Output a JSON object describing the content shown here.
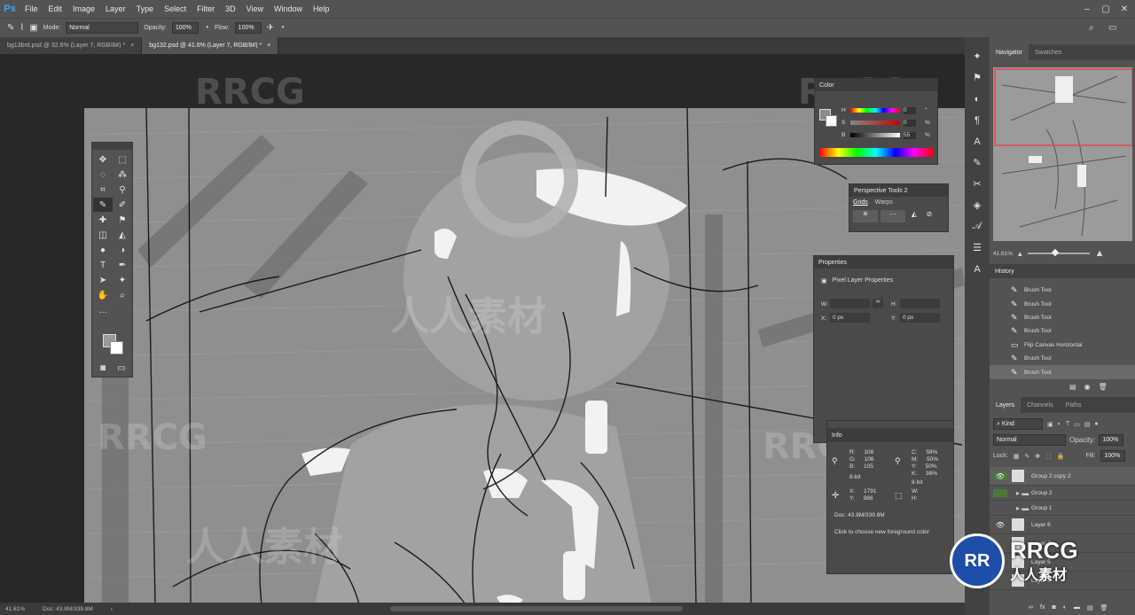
{
  "app": {
    "logo": "Ps",
    "menu": [
      "File",
      "Edit",
      "Image",
      "Layer",
      "Type",
      "Select",
      "Filter",
      "3D",
      "View",
      "Window",
      "Help"
    ]
  },
  "options": {
    "mode_label": "Mode:",
    "mode_value": "Normal",
    "opacity_label": "Opacity:",
    "opacity_value": "100%",
    "flow_label": "Flow:",
    "flow_value": "100%"
  },
  "tabs": [
    {
      "label": "bg13brd.psd @ 32.6% (Layer 7, RGB/8#) *",
      "close": "×"
    },
    {
      "label": "bg132.psd @ 41.6% (Layer 7, RGB/8#) *",
      "close": "×"
    }
  ],
  "color_panel": {
    "title": "Color",
    "channels": [
      {
        "label": "H",
        "value": "0",
        "unit": "°"
      },
      {
        "label": "S",
        "value": "0",
        "unit": "%"
      },
      {
        "label": "B",
        "value": "55",
        "unit": "%"
      }
    ]
  },
  "perspective_panel": {
    "title": "Perspective Tools 2",
    "tabs": [
      "Grids",
      "Warps"
    ]
  },
  "properties_panel": {
    "title": "Properties",
    "subtitle": "Pixel Layer Properties",
    "w_label": "W:",
    "h_label": "H:",
    "x_label": "X:",
    "x_value": "0 px",
    "y_label": "Y:",
    "y_value": "0 px"
  },
  "info_panel": {
    "title": "Info",
    "rgb": [
      {
        "k": "R:",
        "v": "108"
      },
      {
        "k": "G:",
        "v": "106"
      },
      {
        "k": "B:",
        "v": "105"
      }
    ],
    "bit_left": "8-bit",
    "cmyk": [
      {
        "k": "C:",
        "v": "59%"
      },
      {
        "k": "M:",
        "v": "50%"
      },
      {
        "k": "Y:",
        "v": "50%"
      },
      {
        "k": "K:",
        "v": "38%"
      }
    ],
    "bit_right": "8-bit",
    "x": {
      "k": "X:",
      "v": "1791"
    },
    "y": {
      "k": "Y:",
      "v": "986"
    },
    "w": {
      "k": "W:",
      "v": ""
    },
    "h": {
      "k": "H:",
      "v": ""
    },
    "doc": "Doc: 43.8M/339.8M",
    "hint": "Click to choose new foreground color"
  },
  "navigator": {
    "tabs": [
      "Navigator",
      "Swatches"
    ],
    "zoom": "41.61%"
  },
  "history": {
    "title": "History",
    "items": [
      "Brush Tool",
      "Brush Tool",
      "Brush Tool",
      "Brush Tool",
      "Flip Canvas Horizontal",
      "Brush Tool",
      "Brush Tool"
    ]
  },
  "layers": {
    "tabs": [
      "Layers",
      "Channels",
      "Paths"
    ],
    "kind": "Kind",
    "blend": "Normal",
    "opacity_label": "Opacity:",
    "opacity_value": "100%",
    "lock_label": "Lock:",
    "fill_label": "Fill:",
    "fill_value": "100%",
    "items": [
      "Group 2 copy 2",
      "Group 2",
      "Group 1",
      "Layer 6",
      "Layer 7",
      "Layer 5",
      "Layer 4"
    ]
  },
  "status": {
    "zoom": "41.61%",
    "doc": "Doc: 43.8M/339.8M"
  },
  "watermark": {
    "text": "RRCG",
    "cn": "人人素材"
  }
}
